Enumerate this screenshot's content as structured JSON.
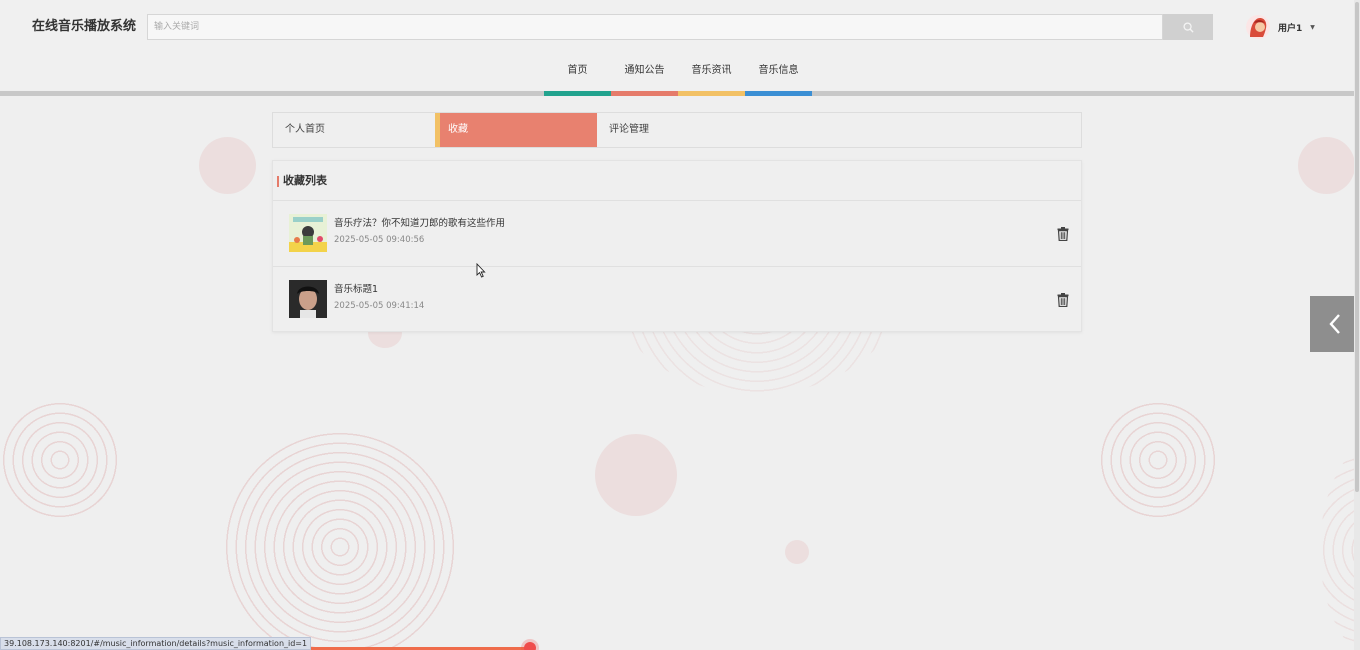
{
  "header": {
    "app_title": "在线音乐播放系统",
    "search": {
      "placeholder": "输入关键词",
      "button_icon": "search-icon"
    },
    "user": {
      "name": "用户1",
      "avatar_icon": "avatar-icon",
      "caret_icon": "caret-down-icon"
    }
  },
  "nav": {
    "items": [
      {
        "label": "首页",
        "color": "#22a38e"
      },
      {
        "label": "通知公告",
        "color": "#e57b6a"
      },
      {
        "label": "音乐资讯",
        "color": "#f2c165"
      },
      {
        "label": "音乐信息",
        "color": "#3b8fd4"
      }
    ]
  },
  "tabs": {
    "items": [
      {
        "label": "个人首页",
        "active": false
      },
      {
        "label": "收藏",
        "active": true
      },
      {
        "label": "评论管理",
        "active": false
      }
    ],
    "active_color": "#e8816f"
  },
  "favorites": {
    "title": "收藏列表",
    "items": [
      {
        "title": "音乐疗法？你不知道刀郎的歌有这些作用",
        "time": "2025-05-05 09:40:56",
        "delete_icon": "trash-icon"
      },
      {
        "title": "音乐标题1",
        "time": "2025-05-05 09:41:14",
        "delete_icon": "trash-icon"
      }
    ]
  },
  "side_toggle": {
    "icon": "chevron-left-icon"
  },
  "status_bar": {
    "url": "39.108.173.140:8201/#/music_information/details?music_information_id=1"
  }
}
